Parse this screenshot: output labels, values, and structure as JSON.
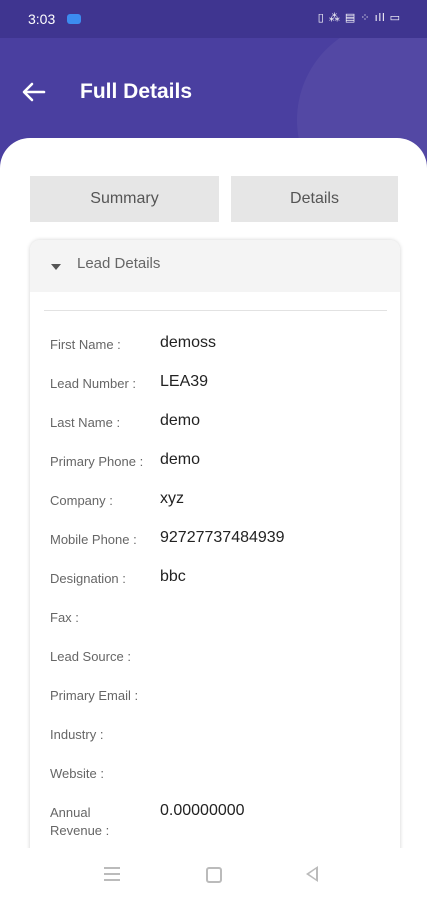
{
  "status_bar": {
    "time": "3:03",
    "icons": "▯ ⁂ ▤ ⁘ ıll ▭"
  },
  "header": {
    "title": "Full Details"
  },
  "tabs": [
    {
      "label": "Summary"
    },
    {
      "label": "Details"
    }
  ],
  "section": {
    "title": "Lead Details"
  },
  "fields": [
    {
      "label": "First Name :",
      "value": "demoss"
    },
    {
      "label": "Lead Number :",
      "value": "LEA39"
    },
    {
      "label": "Last Name :",
      "value": "demo"
    },
    {
      "label": "Primary Phone :",
      "value": "demo"
    },
    {
      "label": "Company :",
      "value": "xyz"
    },
    {
      "label": "Mobile Phone :",
      "value": "92727737484939"
    },
    {
      "label": "Designation :",
      "value": "bbc"
    },
    {
      "label": "Fax :",
      "value": ""
    },
    {
      "label": "Lead Source :",
      "value": ""
    },
    {
      "label": "Primary Email :",
      "value": ""
    },
    {
      "label": "Industry :",
      "value": ""
    },
    {
      "label": "Website :",
      "value": ""
    },
    {
      "label": "Annual Revenue :",
      "value": "0.00000000"
    }
  ],
  "colors": {
    "header": "#4a3fa0",
    "tab_bg": "#e6e6e6"
  }
}
